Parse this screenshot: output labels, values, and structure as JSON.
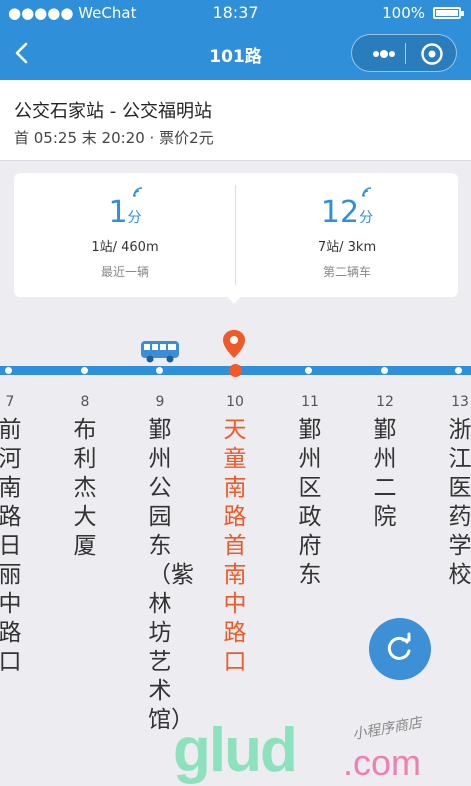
{
  "status": {
    "carrier": "●●●●● WeChat",
    "time": "18:37",
    "battery": "100%"
  },
  "nav": {
    "title": "101路"
  },
  "route": {
    "name": "公交石家站 - 公交福明站",
    "info": "首 05:25 末 20:20 · 票价2元"
  },
  "arrivals": [
    {
      "minutes": "1",
      "unit": "分",
      "distance": "1站/ 460m",
      "label": "最近一辆"
    },
    {
      "minutes": "12",
      "unit": "分",
      "distance": "7站/ 3km",
      "label": "第二辆车"
    }
  ],
  "stations": [
    {
      "no": "7",
      "name": "前河南路日丽中路口"
    },
    {
      "no": "8",
      "name": "布利杰大厦"
    },
    {
      "no": "9",
      "name": "鄞州公园东（紫林坊艺术馆）"
    },
    {
      "no": "10",
      "name": "天童南路首南中路口"
    },
    {
      "no": "11",
      "name": "鄞州区政府东"
    },
    {
      "no": "12",
      "name": "鄞州二院"
    },
    {
      "no": "13",
      "name": "浙江医药学校"
    }
  ],
  "watermark": {
    "text": "glud",
    "domain": ".com",
    "tagline": "小程序商店"
  },
  "colors": {
    "primary": "#2f8fd8",
    "highlight": "#f05a28",
    "watermark": "#7ee0b5"
  },
  "icons": [
    "back-icon",
    "more-icon",
    "target-icon",
    "wifi-signal-icon",
    "bus-icon",
    "location-pin-icon",
    "refresh-icon"
  ]
}
